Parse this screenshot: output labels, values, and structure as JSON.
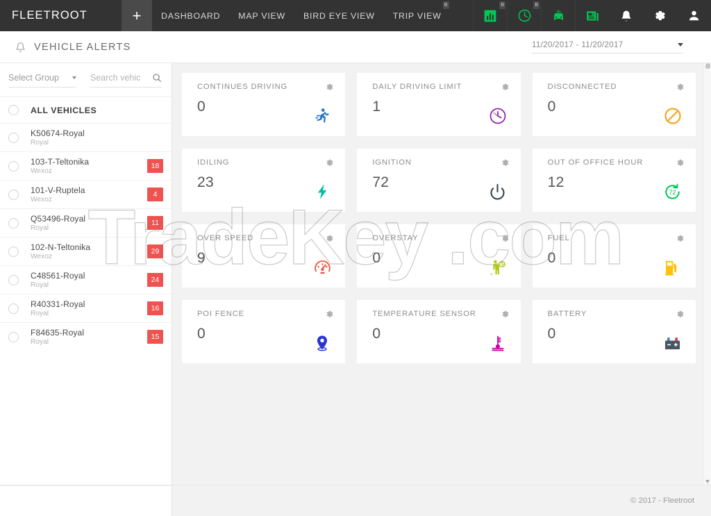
{
  "navbar": {
    "brand": "FLEETROOT",
    "add_tab_label": "+",
    "links": [
      {
        "label": "DASHBOARD",
        "badge": ""
      },
      {
        "label": "MAP VIEW",
        "badge": ""
      },
      {
        "label": "BIRD EYE VIEW",
        "badge": ""
      },
      {
        "label": "TRIP VIEW",
        "badge": "B"
      }
    ],
    "icons": [
      {
        "name": "reports-icon",
        "badge": "B",
        "color": "#00c853"
      },
      {
        "name": "history-clock-icon",
        "badge": "B",
        "color": "#00c853"
      },
      {
        "name": "vehicle-icon",
        "badge": "",
        "color": "#00c853"
      },
      {
        "name": "news-icon",
        "badge": "",
        "color": "#00c853"
      },
      {
        "name": "notifications-bell-icon",
        "badge": "",
        "color": "#ffffff"
      },
      {
        "name": "settings-gear-icon",
        "badge": "",
        "color": "#ffffff"
      },
      {
        "name": "user-account-icon",
        "badge": "",
        "color": "#ffffff"
      }
    ]
  },
  "pageheader": {
    "title": "VEHICLE ALERTS",
    "date_range": "11/20/2017 - 11/20/2017"
  },
  "sidebar": {
    "group_select_label": "Select Group",
    "search_placeholder": "Search vehic",
    "search_value": "",
    "vehicles": [
      {
        "name": "ALL VEHICLES",
        "group": "",
        "badge": ""
      },
      {
        "name": "K50674-Royal",
        "group": "Royal",
        "badge": ""
      },
      {
        "name": "103-T-Teltonika",
        "group": "Wexoz",
        "badge": "18"
      },
      {
        "name": "101-V-Ruptela",
        "group": "Wexoz",
        "badge": "4"
      },
      {
        "name": "Q53496-Royal",
        "group": "Royal",
        "badge": "11"
      },
      {
        "name": "102-N-Teltonika",
        "group": "Wexoz",
        "badge": "29"
      },
      {
        "name": "C48561-Royal",
        "group": "Royal",
        "badge": "24"
      },
      {
        "name": "R40331-Royal",
        "group": "Royal",
        "badge": "16"
      },
      {
        "name": "F84635-Royal",
        "group": "Royal",
        "badge": "15"
      }
    ]
  },
  "cards": [
    {
      "title": "CONTINUES DRIVING",
      "value": "0",
      "icon": "running-person-icon",
      "color": "#2979c9"
    },
    {
      "title": "DAILY DRIVING LIMIT",
      "value": "1",
      "icon": "clock-limit-icon",
      "color": "#8e24aa"
    },
    {
      "title": "DISCONNECTED",
      "value": "0",
      "icon": "no-entry-icon",
      "color": "#f5a623"
    },
    {
      "title": "IDILING",
      "value": "23",
      "icon": "lightning-bolt-icon",
      "color": "#00bfa5"
    },
    {
      "title": "IGNITION",
      "value": "72",
      "icon": "power-icon",
      "color": "#3d4451"
    },
    {
      "title": "OUT OF OFFICE HOUR",
      "value": "12",
      "icon": "clock-rewind-72-icon",
      "color": "#00c853"
    },
    {
      "title": "OVER SPEED",
      "value": "9",
      "icon": "speedometer-icon",
      "color": "#f4503c"
    },
    {
      "title": "OVERSTAY",
      "value": "0",
      "icon": "seated-person-clock-icon",
      "color": "#b2c91a"
    },
    {
      "title": "FUEL",
      "value": "0",
      "icon": "fuel-pump-icon",
      "color": "#ffc107"
    },
    {
      "title": "POI FENCE",
      "value": "0",
      "icon": "map-pin-icon",
      "color": "#2b34d6"
    },
    {
      "title": "TEMPERATURE SENSOR",
      "value": "0",
      "icon": "thermometer-icon",
      "color": "#cc00aa"
    },
    {
      "title": "BATTERY",
      "value": "0",
      "icon": "car-battery-icon",
      "color": "#4a5560"
    }
  ],
  "footer": {
    "copyright": "© 2017 - Fleetroot"
  },
  "watermark": {
    "text": "TradeKey .com"
  }
}
